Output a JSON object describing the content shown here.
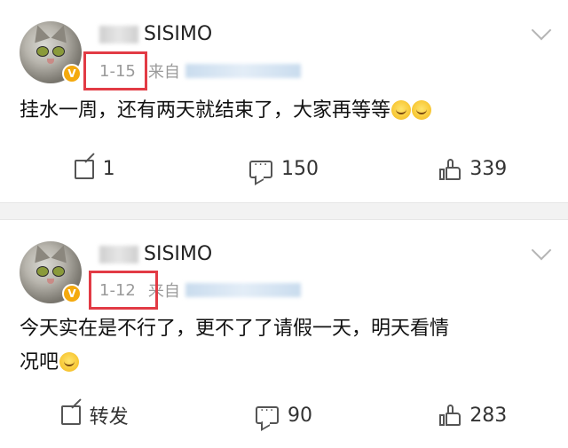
{
  "posts": [
    {
      "username_suffix": "SISIMO",
      "badge": "V",
      "date": "1-15",
      "source_prefix": "来自",
      "text": "挂水一周，还有两天就结束了，大家再等等",
      "emoji_count": 2,
      "repost_label": "1",
      "comment_count": "150",
      "like_count": "339"
    },
    {
      "username_suffix": "SISIMO",
      "badge": "V",
      "date": "1-12",
      "source_prefix": "来自",
      "text_line1": "今天实在是不行了，更不了了请假一天，明天看情",
      "text_line2": "况吧",
      "emoji_count": 1,
      "repost_label": "转发",
      "comment_count": "90",
      "like_count": "283"
    }
  ],
  "colors": {
    "highlight_box": "#e23b45",
    "verified_badge": "#f4a90e",
    "separator": "#f2f2f2"
  },
  "icons": [
    "chevron-down-icon",
    "repost-icon",
    "comment-icon",
    "like-icon",
    "laugh-cry-emoji"
  ]
}
